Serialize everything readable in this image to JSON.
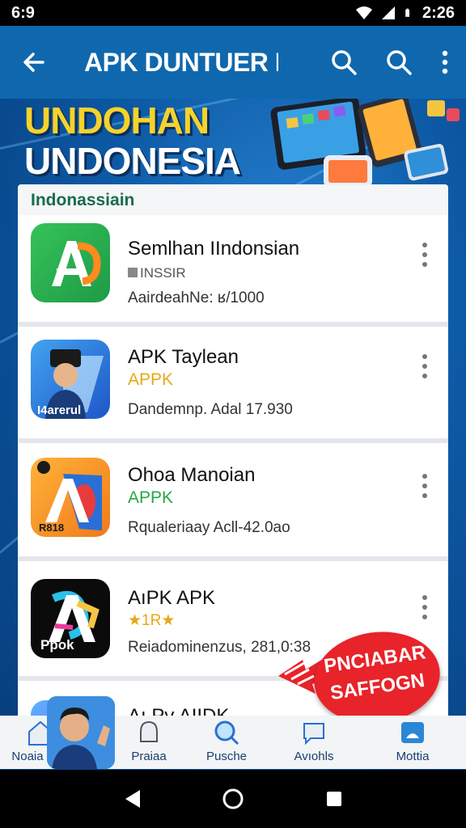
{
  "status": {
    "time_left": "6:9",
    "time_right": "2:26"
  },
  "app_bar": {
    "title": "APK DUNTUER I",
    "back_icon": "arrow-left-icon",
    "search_icon": "search-icon",
    "menu_icon": "more-vert-icon"
  },
  "hero": {
    "line1": "UNDOHAN",
    "line2": "UNDONESIA"
  },
  "section": {
    "title": "Indonassiain"
  },
  "apps": [
    {
      "name": "Semlhan IIndonsian",
      "sub": "INSSIR",
      "meta": "AairdeahNe: ʁ/1000",
      "sub_color": "#555555"
    },
    {
      "name": "APK Taylean",
      "sub": "APPK",
      "meta": "Dandemnp. Adal 17.930",
      "sub_color": "#e6a817",
      "icon_text": "I4arerul"
    },
    {
      "name": "Ohoa Manoian",
      "sub": "APPK",
      "meta": "Rqualeriaay Acll-42.0ao",
      "sub_color": "#27a844",
      "icon_text": "R818"
    },
    {
      "name": "AıPK APK",
      "sub": "★1R★",
      "meta": "Reiadominenzus, 281,0:38",
      "sub_color": "#e6a817",
      "icon_text": "Ppok"
    },
    {
      "name": "Aı.Pv AIIDK"
    }
  ],
  "promo": {
    "line1": "PNCIABAR",
    "line2": "SAFFOGN"
  },
  "bottom_nav": [
    {
      "label": "Noaia"
    },
    {
      "label": "Praiaa"
    },
    {
      "label": "Pusche"
    },
    {
      "label": "Avıohls"
    },
    {
      "label": "Mottia"
    }
  ],
  "colors": {
    "brand": "#0f68ae",
    "hero_yellow": "#f6d22b",
    "section_green": "#1a6b4a",
    "promo_red": "#e8232a"
  }
}
